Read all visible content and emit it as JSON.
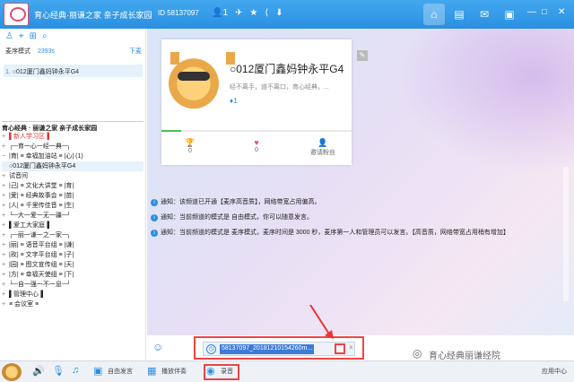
{
  "titlebar": {
    "room_title": "育心经典·丽谦之家 亲子成长家园",
    "room_id": "ID 58137097",
    "member_count": "1",
    "icons": [
      "user-icon",
      "plane-icon",
      "star-icon",
      "share-icon",
      "download-icon"
    ],
    "nav": [
      "home-icon",
      "list-icon",
      "message-icon",
      "skin-icon"
    ],
    "window_controls": [
      "minimize-icon",
      "maximize-icon",
      "close-icon"
    ]
  },
  "left": {
    "mode_label": "麦序模式",
    "mode_count": "2393s",
    "down_label": "下麦",
    "queue": [
      {
        "num": "1.",
        "name": "○012厦门鑫妈钟永平G4"
      }
    ],
    "tree_header": "育心经典 · 丽谦之家 亲子成长家园",
    "tree_rows": [
      "▌新人学习区▐",
      "┌─育一心一经一典─┐",
      "|育| ≡ 幸福加油站 ≡ |心| (1)",
      "○012厦门鑫妈钟永平G4",
      "试音间",
      "|己| ≡ 文化大讲堂 ≡ |育|",
      "|爱| ≡ 经典故事会 ≡ |苗|",
      "|人| ≡ 千里传佳音 ≡ |生|",
      "└─大一爱一无一疆─┘",
      "▌爱工大家庭▐",
      "┌─丽一谦一之一家─┐",
      "|丽| ≡ 语音平台组 ≡ |谦|",
      "|玫| ≡ 文字平台组 ≡ |子|",
      "|园| ≡ 图文宣传组 ≡ |天|",
      "|方| ≡ 幸福天使组 ≡ |下|",
      "└─自一强一不一息─┘",
      "▌管理中心▐",
      "≡ 会议室 ≡"
    ]
  },
  "card": {
    "nickname": "○012厦门鑫妈钟永平G4",
    "signature": "经不离手，道不离口，育心经典，...",
    "level": "1",
    "stats": [
      {
        "icon": "trophy-icon",
        "value": "0"
      },
      {
        "icon": "heart-icon",
        "value": "0"
      },
      {
        "icon": "invite-icon",
        "value": "邀请粉丝"
      }
    ]
  },
  "notices": [
    "通知：该频道已开通【麦序高音质】，网络带宽占用偏高。",
    "通知：当前频道的模式是 自由模式，你可以随意发言。",
    "通知：当前频道的模式是 麦序模式，麦序时间是 3000 秒，麦序第一人和管理员可以发言。【高音质，网络带宽占用稍有增加】"
  ],
  "input": {
    "file_name": "58137097_20181210154260m...",
    "close": "×"
  },
  "watermark": "育心经典丽谦经院",
  "bottombar": {
    "items": [
      "自由发言",
      "播放伴奏",
      "录音",
      "应用中心"
    ]
  }
}
